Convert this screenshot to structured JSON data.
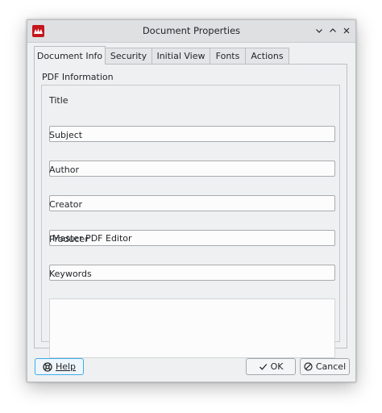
{
  "window": {
    "title": "Document Properties",
    "app_icon": "master-pdf-editor-icon",
    "controls": [
      "chevron-down-icon",
      "chevron-up-icon",
      "close-icon"
    ]
  },
  "tabs": [
    {
      "label": "Document Info",
      "active": true
    },
    {
      "label": "Security",
      "active": false
    },
    {
      "label": "Initial View",
      "active": false
    },
    {
      "label": "Fonts",
      "active": false
    },
    {
      "label": "Actions",
      "active": false
    }
  ],
  "group": {
    "title": "PDF Information"
  },
  "fields": {
    "title": {
      "label": "Title",
      "value": ""
    },
    "subject": {
      "label": "Subject",
      "value": ""
    },
    "author": {
      "label": "Author",
      "value": ""
    },
    "creator": {
      "label": "Creator",
      "value": "Master PDF Editor"
    },
    "producer": {
      "label": "Producer",
      "value": ""
    },
    "keywords": {
      "label": "Keywords",
      "value": ""
    }
  },
  "buttons": {
    "help": {
      "label": "Help",
      "icon": "help-icon"
    },
    "ok": {
      "label": "OK",
      "icon": "checkmark-icon"
    },
    "cancel": {
      "label": "Cancel",
      "icon": "cancel-icon"
    }
  },
  "colors": {
    "accent": "#3daee9",
    "app_icon": "#c4161c"
  }
}
